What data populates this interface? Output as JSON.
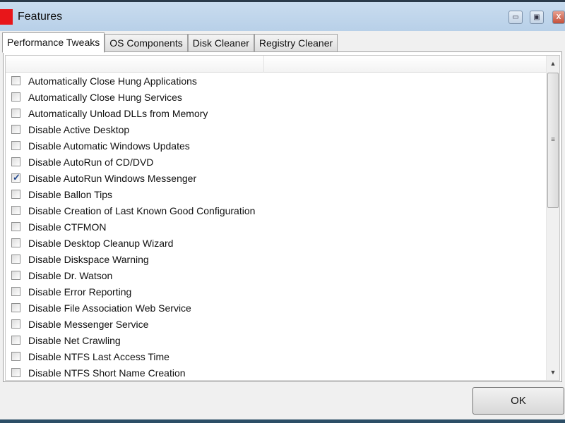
{
  "window": {
    "title": "Features",
    "controls": {
      "minimize": "minimize-icon",
      "maximize": "maximize-icon",
      "close": "close-icon"
    },
    "accent": "#e8161a"
  },
  "tabs": [
    {
      "label": "Performance Tweaks",
      "active": true
    },
    {
      "label": "OS Components"
    },
    {
      "label": "Disk Cleaner"
    },
    {
      "label": "Registry Cleaner"
    }
  ],
  "items": [
    {
      "label": "Automatically Close Hung Applications",
      "checked": false
    },
    {
      "label": "Automatically Close Hung Services",
      "checked": false
    },
    {
      "label": "Automatically Unload DLLs from Memory",
      "checked": false
    },
    {
      "label": "Disable Active Desktop",
      "checked": false
    },
    {
      "label": "Disable Automatic Windows Updates",
      "checked": false
    },
    {
      "label": "Disable AutoRun of CD/DVD",
      "checked": false
    },
    {
      "label": "Disable AutoRun Windows Messenger",
      "checked": true
    },
    {
      "label": "Disable Ballon Tips",
      "checked": false
    },
    {
      "label": "Disable Creation of Last Known Good Configuration",
      "checked": false
    },
    {
      "label": "Disable CTFMON",
      "checked": false
    },
    {
      "label": "Disable Desktop Cleanup Wizard",
      "checked": false
    },
    {
      "label": "Disable Diskspace Warning",
      "checked": false
    },
    {
      "label": "Disable Dr. Watson",
      "checked": false
    },
    {
      "label": "Disable Error Reporting",
      "checked": false
    },
    {
      "label": "Disable File Association Web Service",
      "checked": false
    },
    {
      "label": "Disable Messenger Service",
      "checked": false
    },
    {
      "label": "Disable Net Crawling",
      "checked": false
    },
    {
      "label": "Disable NTFS Last Access Time",
      "checked": false
    },
    {
      "label": "Disable NTFS Short Name Creation",
      "checked": false
    }
  ],
  "footer": {
    "ok_label": "OK"
  }
}
